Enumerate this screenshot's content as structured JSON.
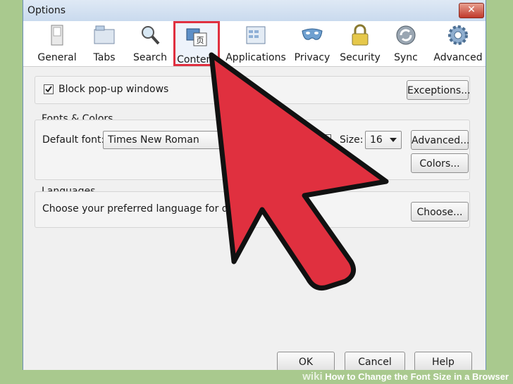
{
  "window": {
    "title": "Options",
    "close_glyph": "✕"
  },
  "toolbar": {
    "items": [
      {
        "label": "General",
        "icon": "switch-icon"
      },
      {
        "label": "Tabs",
        "icon": "tabs-icon"
      },
      {
        "label": "Search",
        "icon": "magnifier-icon"
      },
      {
        "label": "Content",
        "icon": "content-icon",
        "selected": true
      },
      {
        "label": "Applications",
        "icon": "applications-icon"
      },
      {
        "label": "Privacy",
        "icon": "mask-icon"
      },
      {
        "label": "Security",
        "icon": "lock-icon"
      },
      {
        "label": "Sync",
        "icon": "sync-icon"
      },
      {
        "label": "Advanced",
        "icon": "gear-icon"
      }
    ]
  },
  "popup": {
    "checkbox_label": "Block pop-up windows",
    "checked": true,
    "exceptions_label": "Exceptions..."
  },
  "fonts": {
    "group_title": "Fonts & Colors",
    "default_font_label": "Default font:",
    "default_font_value": "Times New Roman",
    "size_label": "Size:",
    "size_value": "16",
    "advanced_label": "Advanced...",
    "colors_label": "Colors..."
  },
  "languages": {
    "group_title": "Languages",
    "description": "Choose your preferred language for display",
    "choose_label": "Choose..."
  },
  "footer": {
    "ok_label": "OK",
    "cancel_label": "Cancel",
    "help_label": "Help"
  },
  "watermark": {
    "brand": "wiki",
    "title": "How to Change the Font Size in a Browser"
  },
  "colors": {
    "arrow_fill": "#e0303f",
    "selection_border": "#e03040"
  }
}
